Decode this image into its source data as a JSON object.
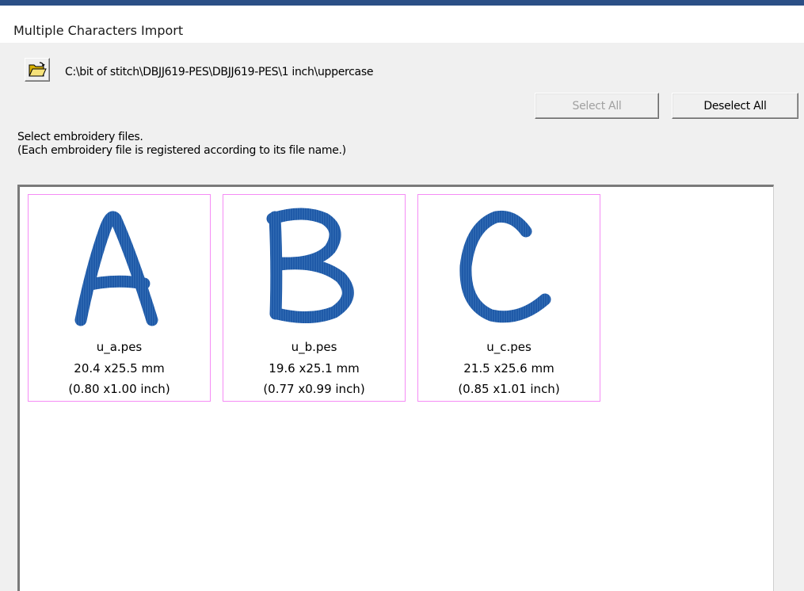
{
  "window": {
    "title": "Multiple Characters Import"
  },
  "toolbar": {
    "folder_icon": "open-folder-icon",
    "path": "C:\\bit of stitch\\DBJJ619-PES\\DBJJ619-PES\\1 inch\\uppercase"
  },
  "buttons": {
    "select_all": "Select All",
    "deselect_all": "Deselect All"
  },
  "instructions": {
    "line1": "Select embroidery files.",
    "line2": "(Each embroidery file is registered according to its file name.)"
  },
  "files": [
    {
      "glyph": "A",
      "name": "u_a.pes",
      "size_mm": "20.4 x25.5 mm",
      "size_inch": "(0.80 x1.00 inch)"
    },
    {
      "glyph": "B",
      "name": "u_b.pes",
      "size_mm": "19.6 x25.1 mm",
      "size_inch": "(0.77 x0.99 inch)"
    },
    {
      "glyph": "C",
      "name": "u_c.pes",
      "size_mm": "21.5 x25.6 mm",
      "size_inch": "(0.85 x1.01 inch)"
    }
  ],
  "colors": {
    "stitch": "#1f5aa8",
    "selection_border": "#f58cf5",
    "title_bar": "#2b4f86"
  }
}
